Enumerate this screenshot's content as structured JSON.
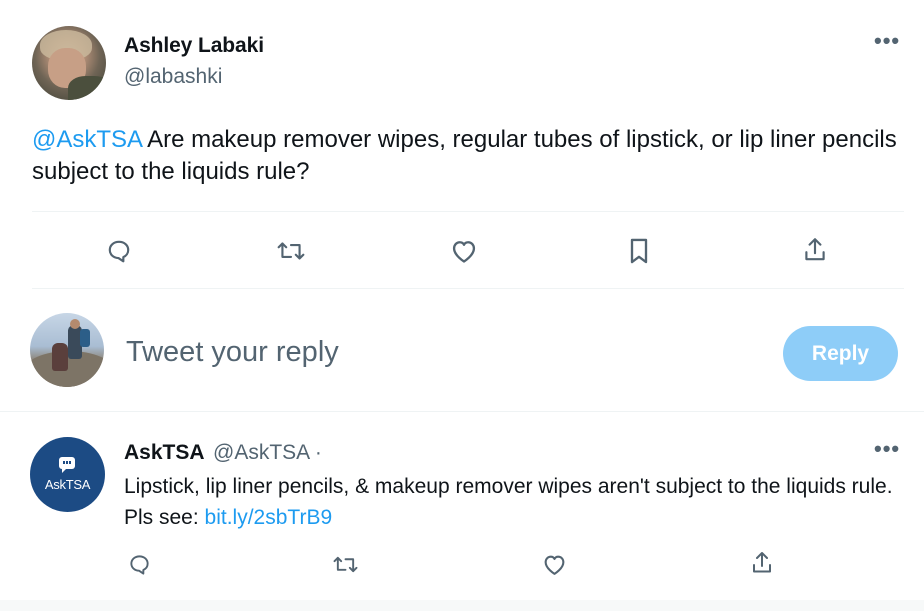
{
  "tweet": {
    "author_name": "Ashley Labaki",
    "author_handle": "@labashki",
    "more_icon": "•••",
    "mention": "@AskTSA",
    "text": " Are makeup remover wipes, regular tubes of lipstick, or lip liner pencils subject to the liquids rule?",
    "actions": [
      "reply-icon",
      "retweet-icon",
      "like-icon",
      "bookmark-icon",
      "share-icon"
    ]
  },
  "composer": {
    "placeholder": "Tweet your reply",
    "button_label": "Reply"
  },
  "reply": {
    "author_name": "AskTSA",
    "author_handle": "@AskTSA ·",
    "avatar_label": "AskTSA",
    "more_icon": "•••",
    "text": "Lipstick, lip liner pencils, & makeup remover wipes aren't subject to the liquids rule. Pls see: ",
    "link": "bit.ly/2sbTrB9",
    "actions": [
      "reply-icon",
      "retweet-icon",
      "like-icon",
      "share-icon"
    ]
  },
  "colors": {
    "accent": "#1d9bf0",
    "reply_button_disabled": "#8ecdf8",
    "secondary_text": "#536471",
    "tsa_brand": "#1c4b84"
  }
}
